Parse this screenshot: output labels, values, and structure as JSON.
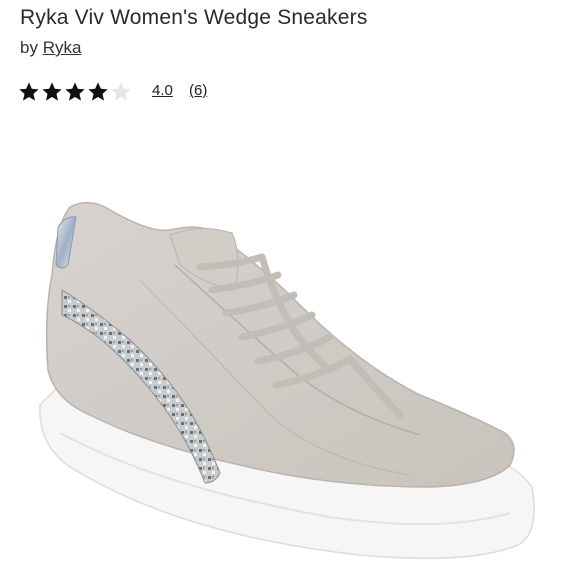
{
  "product": {
    "title": "Ryka Viv Women's Wedge Sneakers",
    "by_prefix": "by",
    "brand": "Ryka"
  },
  "rating": {
    "value": "4.0",
    "count": "(6)",
    "stars_filled": 4,
    "stars_total": 5
  },
  "colors": {
    "star_filled": "#111111",
    "star_empty": "#e6e6e6",
    "shoe_suede": "#cfc9c4",
    "sole": "#f7f7f7"
  },
  "image": {
    "icon": "sneaker-product-image"
  }
}
